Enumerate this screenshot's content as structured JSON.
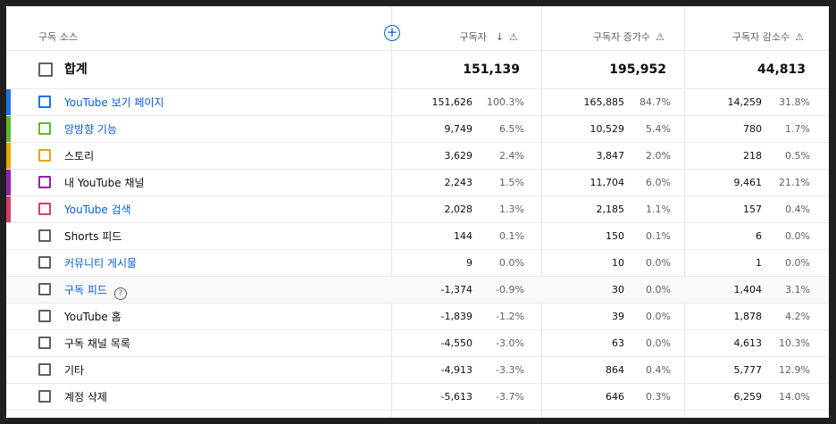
{
  "header": {
    "source_label": "구독 소스",
    "col1": "구독자",
    "col2": "구독자 증가수",
    "col3": "구독자 감소수",
    "sort_icon": "arrow-down-icon",
    "warn_icon": "warning-icon",
    "add_icon": "add-circle-icon"
  },
  "total": {
    "label": "합계",
    "subs": "151,139",
    "gain": "195,952",
    "loss": "44,813"
  },
  "rows": [
    {
      "label": "YouTube 보기 페이지",
      "link": true,
      "color": "#1a73e8",
      "subs": "151,626",
      "subs_pct": "100.3%",
      "gain": "165,885",
      "gain_pct": "84.7%",
      "loss": "14,259",
      "loss_pct": "31.8%"
    },
    {
      "label": "앙방향 기능",
      "link": true,
      "color": "#5eb82c",
      "subs": "9,749",
      "subs_pct": "6.5%",
      "gain": "10,529",
      "gain_pct": "5.4%",
      "loss": "780",
      "loss_pct": "1.7%"
    },
    {
      "label": "스토리",
      "link": false,
      "color": "#e8a30e",
      "subs": "3,629",
      "subs_pct": "2.4%",
      "gain": "3,847",
      "gain_pct": "2.0%",
      "loss": "218",
      "loss_pct": "0.5%"
    },
    {
      "label": "내 YouTube 채널",
      "link": false,
      "color": "#8e24aa",
      "subs": "2,243",
      "subs_pct": "1.5%",
      "gain": "11,704",
      "gain_pct": "6.0%",
      "loss": "9,461",
      "loss_pct": "21.1%"
    },
    {
      "label": "YouTube 검색",
      "link": true,
      "color": "#d63d64",
      "subs": "2,028",
      "subs_pct": "1.3%",
      "gain": "2,185",
      "gain_pct": "1.1%",
      "loss": "157",
      "loss_pct": "0.4%"
    },
    {
      "label": "Shorts 피드",
      "link": false,
      "color": null,
      "subs": "144",
      "subs_pct": "0.1%",
      "gain": "150",
      "gain_pct": "0.1%",
      "loss": "6",
      "loss_pct": "0.0%"
    },
    {
      "label": "커뮤니티 게시물",
      "link": true,
      "color": null,
      "subs": "9",
      "subs_pct": "0.0%",
      "gain": "10",
      "gain_pct": "0.0%",
      "loss": "1",
      "loss_pct": "0.0%"
    },
    {
      "label": "구독 피드",
      "link": true,
      "color": null,
      "help": "?",
      "subs": "-1,374",
      "subs_pct": "-0.9%",
      "gain": "30",
      "gain_pct": "0.0%",
      "loss": "1,404",
      "loss_pct": "3.1%"
    },
    {
      "label": "YouTube 홈",
      "link": false,
      "color": null,
      "subs": "-1,839",
      "subs_pct": "-1.2%",
      "gain": "39",
      "gain_pct": "0.0%",
      "loss": "1,878",
      "loss_pct": "4.2%"
    },
    {
      "label": "구독 채널 목록",
      "link": false,
      "color": null,
      "subs": "-4,550",
      "subs_pct": "-3.0%",
      "gain": "63",
      "gain_pct": "0.0%",
      "loss": "4,613",
      "loss_pct": "10.3%"
    },
    {
      "label": "기타",
      "link": false,
      "color": null,
      "subs": "-4,913",
      "subs_pct": "-3.3%",
      "gain": "864",
      "gain_pct": "0.4%",
      "loss": "5,777",
      "loss_pct": "12.9%"
    },
    {
      "label": "계정 삭제",
      "link": false,
      "color": null,
      "subs": "-5,613",
      "subs_pct": "-3.7%",
      "gain": "646",
      "gain_pct": "0.3%",
      "loss": "6,259",
      "loss_pct": "14.0%"
    }
  ]
}
